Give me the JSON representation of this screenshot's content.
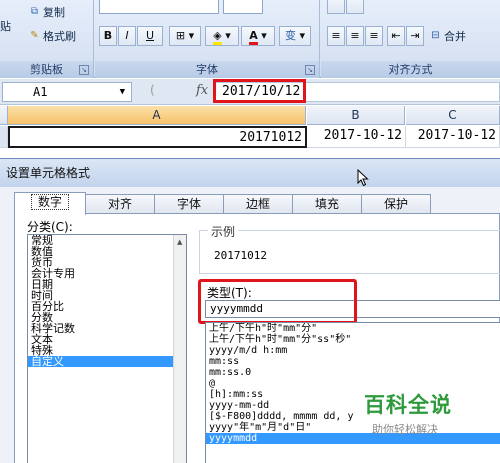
{
  "ribbon": {
    "clipboard": {
      "paste_partial": "贴",
      "copy": "复制",
      "format_painter": "格式刷",
      "caption": "剪贴板"
    },
    "font": {
      "bold": "B",
      "italic": "I",
      "underline": "U",
      "font_color_letter": "A",
      "phonetic": "变",
      "caption": "字体"
    },
    "alignment": {
      "merge": "合并",
      "caption": "对齐方式"
    }
  },
  "formula_bar": {
    "name_box": "A1",
    "fx": "fx",
    "formula": "2017/10/12"
  },
  "sheet": {
    "columns": [
      "A",
      "B",
      "C"
    ],
    "row": [
      "20171012",
      "2017-10-12",
      "2017-10-12"
    ]
  },
  "dialog": {
    "title": "设置单元格格式",
    "tabs": [
      "数字",
      "对齐",
      "字体",
      "边框",
      "填充",
      "保护"
    ],
    "active_tab": "数字",
    "category_label": "分类(C):",
    "categories": [
      "常规",
      "数值",
      "货币",
      "会计专用",
      "日期",
      "时间",
      "百分比",
      "分数",
      "科学记数",
      "文本",
      "特殊",
      "自定义"
    ],
    "selected_category": "自定义",
    "sample_label": "示例",
    "sample_value": "20171012",
    "type_label": "类型(T):",
    "type_value": "yyyymmdd",
    "formats": [
      "上午/下午h\"时\"mm\"分\"",
      "上午/下午h\"时\"mm\"分\"ss\"秒\"",
      "yyyy/m/d h:mm",
      "mm:ss",
      "mm:ss.0",
      "@",
      "[h]:mm:ss",
      "yyyy-mm-dd",
      "[$-F800]dddd, mmmm dd, y",
      "yyyy\"年\"m\"月\"d\"日\"",
      "yyyymmdd"
    ],
    "selected_format": "yyyymmdd"
  },
  "watermark": {
    "title": "百科全说",
    "subtitle": "助你轻松解决"
  },
  "colors": {
    "highlight": "#e0141b",
    "selection": "#3399ff",
    "watermark": "#2e9a3c"
  }
}
